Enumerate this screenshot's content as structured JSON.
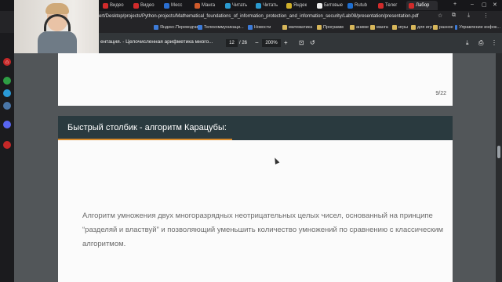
{
  "tabs": [
    {
      "label": "Видео",
      "color": "#d12b2b"
    },
    {
      "label": "Видео",
      "color": "#d12b2b"
    },
    {
      "label": "Месс",
      "color": "#2b6fd1"
    },
    {
      "label": "Манга",
      "color": "#d15b2b"
    },
    {
      "label": "Читать",
      "color": "#2b9bd1"
    },
    {
      "label": "Читать",
      "color": "#2b9bd1"
    },
    {
      "label": "Яндек",
      "color": "#d1b12b"
    },
    {
      "label": "Битовые",
      "color": "#222222"
    },
    {
      "label": "Rutub",
      "color": "#1e6fd1"
    },
    {
      "label": "Телег",
      "color": "#d12b2b"
    },
    {
      "label": "Лабор",
      "color": "#d12b2b",
      "active": true
    }
  ],
  "address": {
    "url": "ert/Desktop/projects/Python-projects/Mathematical_foundations_of_information_protection_and_information_security/Lab08/presentation/presentation.pdf"
  },
  "bookmarks": [
    {
      "label": "Яндекс.Переводчик",
      "kind": "site"
    },
    {
      "label": "Телекоммуникаци...",
      "kind": "site"
    },
    {
      "label": "Новости",
      "kind": "site"
    },
    {
      "label": "математика",
      "kind": "folder"
    },
    {
      "label": "Программ",
      "kind": "folder"
    },
    {
      "label": "аниме",
      "kind": "folder"
    },
    {
      "label": "манга",
      "kind": "folder"
    },
    {
      "label": "игры",
      "kind": "folder"
    },
    {
      "label": "для игр",
      "kind": "folder"
    },
    {
      "label": "разное",
      "kind": "folder"
    },
    {
      "label": "Управление инфок...",
      "kind": "site"
    }
  ],
  "pdf": {
    "title": "ентация. - Целочисленная арифметика много...",
    "page_current": "12",
    "page_total": "/ 26",
    "zoom": "200%"
  },
  "document": {
    "prev_page_number": "9/22",
    "slide_title": "Быстрый столбик - алгоритм Карацубы:",
    "slide_body": "Алгоритм умножения двух многоразрядных неотрицательных целых чисел, основанный на принципе “разделяй и властвуй” и позволяющий уменьшить количество умножений по сравнению с классическим алгоритмом."
  },
  "colors": {
    "slide_header": "#2a3a3f",
    "slide_accent": "#d98a2a",
    "viewer_bg": "#525659"
  }
}
